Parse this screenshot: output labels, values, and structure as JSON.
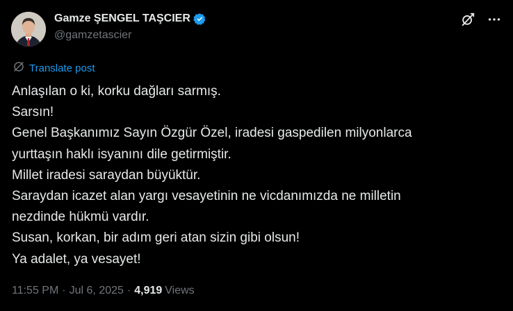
{
  "author": {
    "display_name": "Gamze ŞENGEL TAŞCIER",
    "handle": "@gamzetascier",
    "verified": true,
    "avatar_icon": "avatar-photo"
  },
  "actions": {
    "grok_icon": "grok-icon",
    "more_icon": "more-icon"
  },
  "translate": {
    "label": "Translate post",
    "icon": "translate-globe-icon"
  },
  "post": {
    "lines": [
      "Anlaşılan o ki, korku dağları sarmış.",
      "Sarsın!",
      "Genel Başkanımız Sayın Özgür Özel, iradesi gaspedilen milyonlarca",
      "yurttaşın haklı isyanını dile getirmiştir.",
      "Millet iradesi saraydan büyüktür.",
      "Saraydan icazet alan yargı vesayetinin ne vicdanımızda ne milletin",
      "nezdinde hükmü vardır.",
      "Susan, korkan, bir adım geri atan sizin gibi olsun!",
      "Ya adalet, ya vesayet!"
    ]
  },
  "meta": {
    "time": "11:55 PM",
    "separator": "·",
    "date": "Jul 6, 2025",
    "views_count": "4,919",
    "views_label": "Views"
  },
  "colors": {
    "background": "#000000",
    "text": "#e7e9ea",
    "secondary": "#71767b",
    "link": "#1d9bf0",
    "verified": "#1d9bf0"
  }
}
